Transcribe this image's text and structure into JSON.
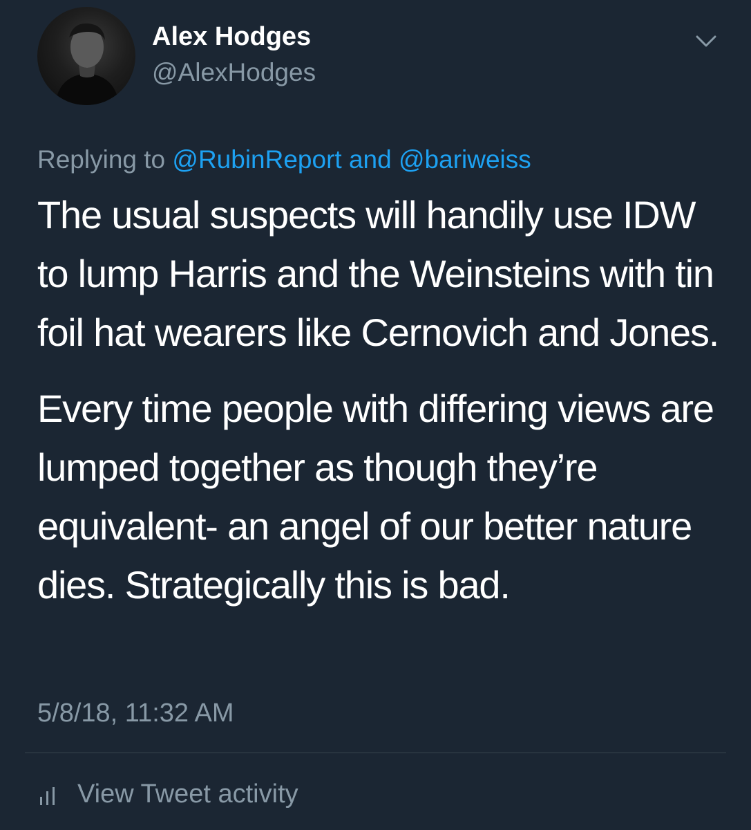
{
  "author": {
    "name": "Alex Hodges",
    "handle": "@AlexHodges",
    "avatar_icon": "profile-photo"
  },
  "header": {
    "menu_icon": "chevron-down-icon"
  },
  "reply": {
    "prefix": "Replying to ",
    "mention1": "@RubinReport",
    "joiner": " and ",
    "mention2": "@bariweiss"
  },
  "tweet": {
    "paragraphs": [
      "The usual suspects will handily use IDW to lump Harris and the Weinsteins with tin foil hat wearers like Cernovich and Jones.",
      "Every time people with differing views are lumped together as though they’re equivalent- an angel of our better nature dies. Strategically this is bad."
    ],
    "timestamp": "5/8/18, 11:32 AM"
  },
  "activity": {
    "label": "View Tweet activity",
    "icon": "bar-chart-icon"
  },
  "colors": {
    "background": "#1b2633",
    "text": "#ffffff",
    "secondary": "#8899a6",
    "link": "#1da1f2",
    "divider": "#38444d"
  }
}
